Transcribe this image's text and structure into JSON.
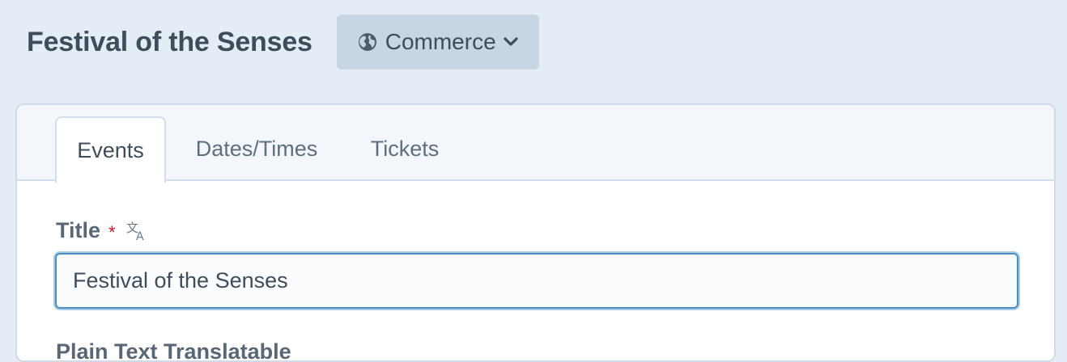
{
  "header": {
    "title": "Festival of the Senses",
    "site_menu": {
      "label": "Commerce",
      "icon": "globe-icon",
      "chevron": "chevron-down-icon"
    }
  },
  "tabs": [
    {
      "label": "Events",
      "active": true
    },
    {
      "label": "Dates/Times",
      "active": false
    },
    {
      "label": "Tickets",
      "active": false
    }
  ],
  "fields": {
    "title": {
      "label": "Title",
      "required_marker": "*",
      "translatable_icon": "translate-icon",
      "value": "Festival of the Senses"
    },
    "next_label": "Plain Text Translatable"
  },
  "colors": {
    "background": "#e4ecf6",
    "menu_button": "#c8d6e3",
    "required": "#cf1124",
    "focus_border": "#4c8ec2"
  }
}
